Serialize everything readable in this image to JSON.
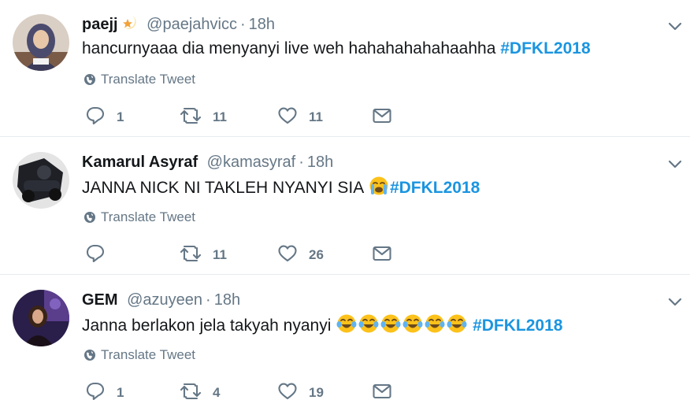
{
  "translate_label": "Translate Tweet",
  "colors": {
    "hashtag": "#1b95e0",
    "secondary_text": "#657786",
    "divider": "#e6ecf0"
  },
  "tweets": [
    {
      "name": "paejj",
      "name_badge_icon": "star-icon",
      "handle": "@paejahvicc",
      "separator": "·",
      "time": "18h",
      "text": "hancurnyaaa dia menyanyi live weh hahahahahahaahha ",
      "emojis": [],
      "hashtag": "#DFKL2018",
      "replies": "1",
      "retweets": "11",
      "likes": "11"
    },
    {
      "name": "Kamarul Asyraf",
      "handle": "@kamasyraf",
      "separator": "·",
      "time": "18h",
      "text": "JANNA NICK NI TAKLEH NYANYI SIA ",
      "emojis": [
        "loudly-crying-face-icon"
      ],
      "hashtag": "#DFKL2018",
      "replies": "",
      "retweets": "11",
      "likes": "26"
    },
    {
      "name": "GEM",
      "handle": "@azuyeen",
      "separator": "·",
      "time": "18h",
      "text": "Janna berlakon jela takyah nyanyi ",
      "emojis": [
        "tears-of-joy-face-icon",
        "tears-of-joy-face-icon",
        "tears-of-joy-face-icon",
        "tears-of-joy-face-icon",
        "tears-of-joy-face-icon",
        "tears-of-joy-face-icon"
      ],
      "hashtag": "#DFKL2018",
      "replies": "1",
      "retweets": "4",
      "likes": "19"
    }
  ]
}
